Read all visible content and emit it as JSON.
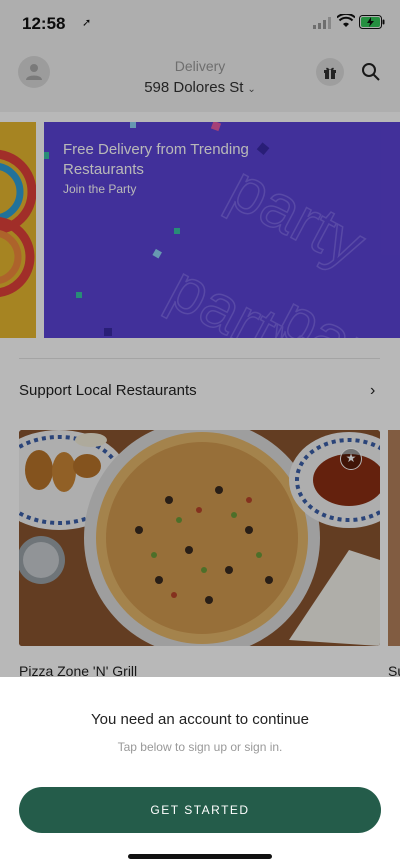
{
  "status": {
    "time": "12:58",
    "location_icon": "location-arrow-icon",
    "signal_icon": "cellular-signal-icon",
    "wifi_icon": "wifi-icon",
    "battery_icon": "battery-charging-icon"
  },
  "header": {
    "delivery_label": "Delivery",
    "address": "598 Dolores St",
    "avatar_icon": "profile-icon",
    "gift_icon": "gift-icon",
    "search_icon": "search-icon"
  },
  "banner": {
    "title": "Free Delivery from Trending Restaurants",
    "subtitle": "Join the Party",
    "accent_color": "#5b43d6"
  },
  "section": {
    "title": "Support Local Restaurants",
    "arrow_icon": "chevron-right-icon"
  },
  "restaurants": [
    {
      "name": "Pizza Zone 'N' Grill",
      "badge_icon": "star-badge-icon"
    },
    {
      "name": "Su"
    }
  ],
  "sheet": {
    "title": "You need an account to continue",
    "subtitle": "Tap below to sign up or sign in.",
    "cta_label": "GET STARTED",
    "cta_color": "#245c4a"
  }
}
